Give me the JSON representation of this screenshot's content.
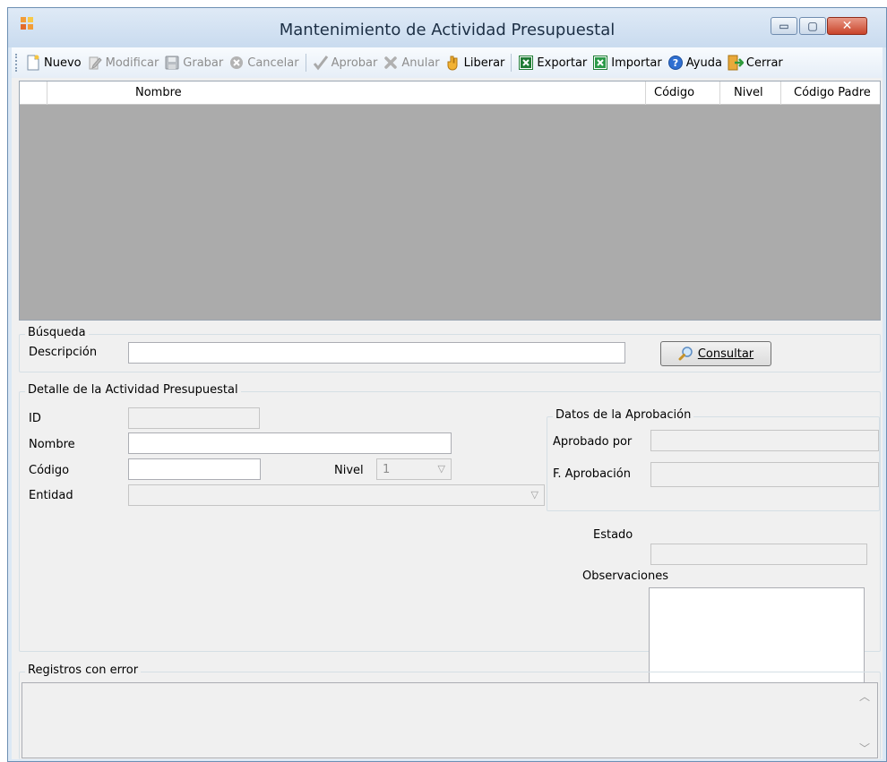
{
  "window": {
    "title": "Mantenimiento de Actividad Presupuestal",
    "controls": {
      "minimize": "▭",
      "maximize": "▢",
      "close": "✕"
    }
  },
  "toolbar": {
    "items": [
      {
        "label": "Nuevo",
        "icon": "new-document-icon",
        "enabled": true
      },
      {
        "label": "Modificar",
        "icon": "edit-icon",
        "enabled": false
      },
      {
        "label": "Grabar",
        "icon": "save-icon",
        "enabled": false
      },
      {
        "label": "Cancelar",
        "icon": "cancel-icon",
        "enabled": false
      },
      {
        "label": "Aprobar",
        "icon": "check-icon",
        "enabled": false
      },
      {
        "label": "Anular",
        "icon": "void-icon",
        "enabled": false
      },
      {
        "label": "Liberar",
        "icon": "release-hand-icon",
        "enabled": true
      },
      {
        "label": "Exportar",
        "icon": "excel-export-icon",
        "enabled": true
      },
      {
        "label": "Importar",
        "icon": "excel-import-icon",
        "enabled": true
      },
      {
        "label": "Ayuda",
        "icon": "help-icon",
        "enabled": true
      },
      {
        "label": "Cerrar",
        "icon": "exit-icon",
        "enabled": true
      }
    ]
  },
  "grid": {
    "columns": [
      "",
      "Nombre",
      "Código",
      "Nivel",
      "Código Padre"
    ],
    "rows": []
  },
  "search": {
    "legend": "Búsqueda",
    "description_label": "Descripción",
    "description_value": "",
    "consult_button": "Consultar"
  },
  "detail": {
    "legend": "Detalle de la Actividad Presupuestal",
    "id_label": "ID",
    "id_value": "",
    "name_label": "Nombre",
    "name_value": "",
    "code_label": "Código",
    "code_value": "",
    "level_label": "Nivel",
    "level_value": "1",
    "entity_label": "Entidad",
    "entity_value": ""
  },
  "approval": {
    "legend": "Datos de la Aprobación",
    "approved_by_label": "Aprobado por",
    "approved_by_value": "",
    "approval_date_label": "F. Aprobación",
    "approval_date_value": "",
    "status_label": "Estado",
    "status_value": "",
    "observations_label": "Observaciones",
    "observations_value": ""
  },
  "errors": {
    "legend": "Registros con error",
    "content": ""
  },
  "colors": {
    "grid_background": "#ababab",
    "window_border": "#6d8fb3",
    "excel_green": "#1e7b34"
  }
}
